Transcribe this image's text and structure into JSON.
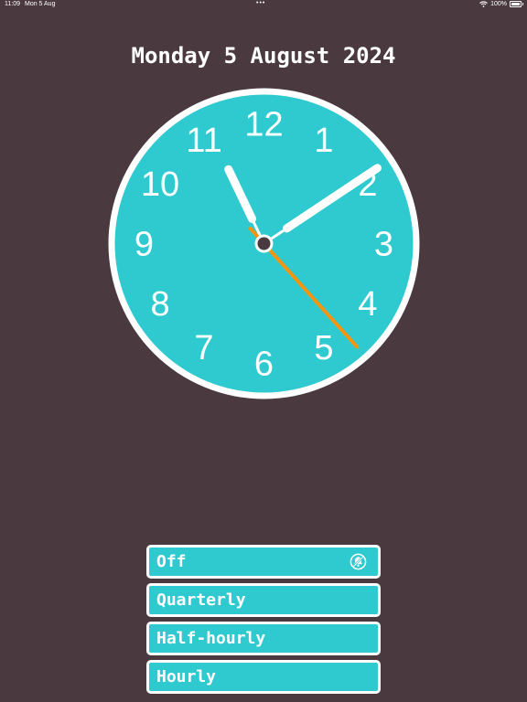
{
  "status_bar": {
    "time": "11:09",
    "date": "Mon 5 Aug",
    "battery": "100%",
    "battery_level": 1.0,
    "icons": [
      "multitasking-dots-icon",
      "wifi-icon",
      "battery-icon"
    ]
  },
  "date_title": "Monday 5 August 2024",
  "clock": {
    "numerals": [
      "12",
      "1",
      "2",
      "3",
      "4",
      "5",
      "6",
      "7",
      "8",
      "9",
      "10",
      "11"
    ],
    "time": {
      "hours": 11,
      "minutes": 9,
      "seconds": 23
    },
    "colors": {
      "face": "#2ecad0",
      "rim": "#ffffff",
      "hands": "#ffffff",
      "second_hand": "#f5940f",
      "hub": "#4a3a40"
    }
  },
  "chime_options": [
    {
      "label": "Off",
      "selected": true,
      "icon": "bell-icon"
    },
    {
      "label": "Quarterly",
      "selected": false
    },
    {
      "label": "Half-hourly",
      "selected": false
    },
    {
      "label": "Hourly",
      "selected": false
    }
  ],
  "colors": {
    "background": "#4a3a40",
    "accent": "#2ecad0",
    "second_hand": "#f5940f"
  }
}
